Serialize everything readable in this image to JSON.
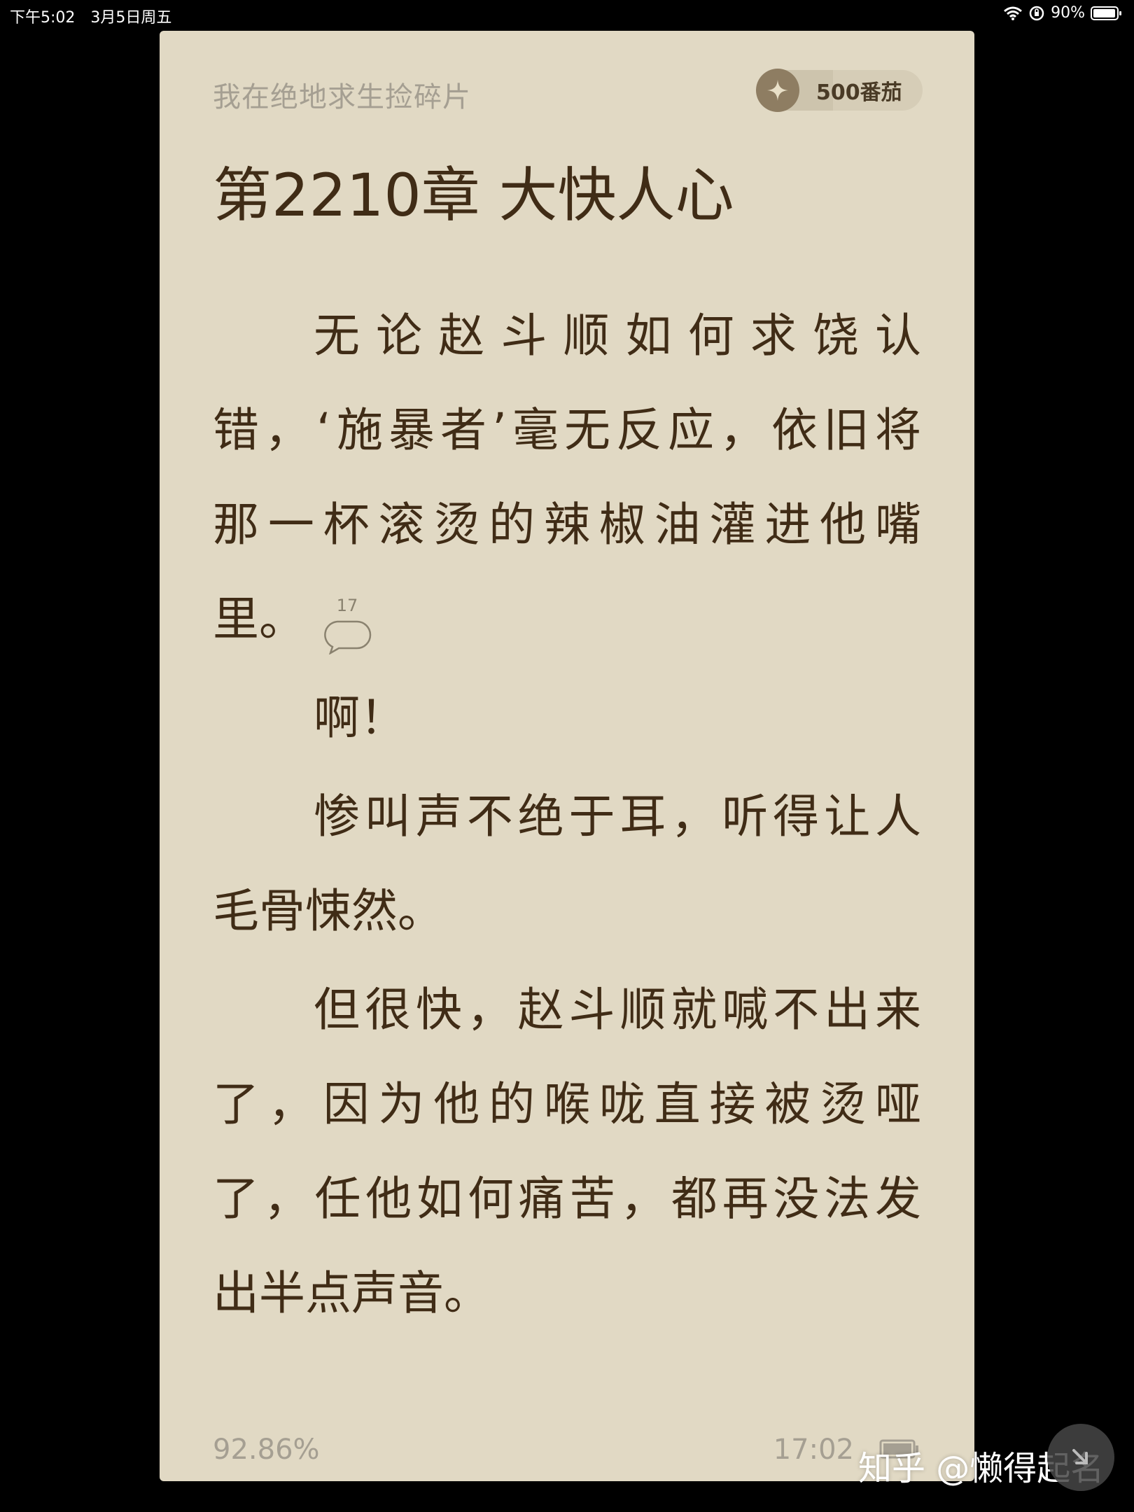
{
  "status_bar": {
    "time": "下午5:02",
    "date": "3月5日周五",
    "battery": "90%"
  },
  "header": {
    "book_title": "我在绝地求生捡碎片",
    "coin_label": "500番茄"
  },
  "chapter": {
    "title": "第2210章 大快人心"
  },
  "content": {
    "p1": [
      "无论赵斗顺如何求饶认",
      "错，‘施暴者’毫无反应，依旧将",
      "那一杯滚烫的辣椒油灌进他嘴",
      "里。"
    ],
    "p1_comment_count": "17",
    "p2": [
      "啊！"
    ],
    "p3": [
      "惨叫声不绝于耳，听得让人",
      "毛骨悚然。"
    ],
    "p4": [
      "但很快，赵斗顺就喊不出来",
      "了，因为他的喉咙直接被烫哑",
      "了，任他如何痛苦，都再没法发",
      "出半点声音。"
    ]
  },
  "footer": {
    "progress": "92.86%",
    "clock": "17:02"
  },
  "watermark": "知乎 @懒得起名",
  "colors": {
    "page_bg": "#e1d9c4",
    "text": "#402c16",
    "muted": "#a59f92",
    "coin": "#8e7d62"
  }
}
